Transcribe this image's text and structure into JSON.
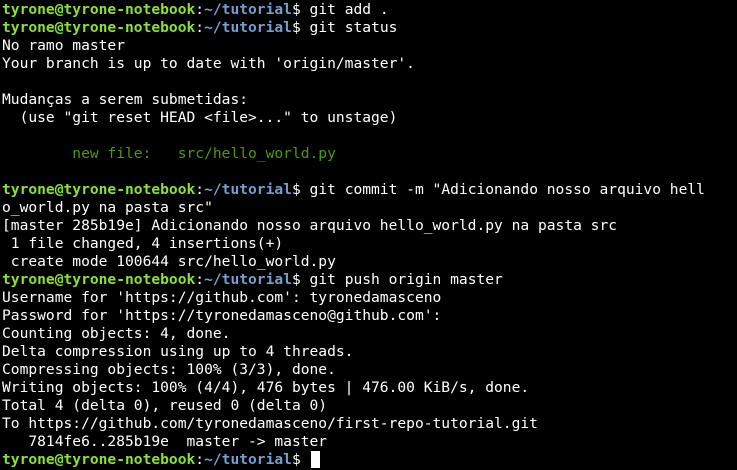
{
  "prompt": {
    "user": "tyrone@tyrone-notebook",
    "colon": ":",
    "path": "~/tutorial",
    "dollar": "$ "
  },
  "lines": [
    {
      "type": "prompt",
      "cmd": "git add ."
    },
    {
      "type": "prompt",
      "cmd": "git status"
    },
    {
      "type": "text",
      "text": "No ramo master"
    },
    {
      "type": "text",
      "text": "Your branch is up to date with 'origin/master'."
    },
    {
      "type": "text",
      "text": ""
    },
    {
      "type": "text",
      "text": "Mudanças a serem submetidas:"
    },
    {
      "type": "text",
      "text": "  (use \"git reset HEAD <file>...\" to unstage)"
    },
    {
      "type": "text",
      "text": ""
    },
    {
      "type": "green",
      "text": "\tnew file:   src/hello_world.py"
    },
    {
      "type": "text",
      "text": ""
    },
    {
      "type": "prompt",
      "cmd": "git commit -m \"Adicionando nosso arquivo hell"
    },
    {
      "type": "text",
      "text": "o_world.py na pasta src\""
    },
    {
      "type": "text",
      "text": "[master 285b19e] Adicionando nosso arquivo hello_world.py na pasta src"
    },
    {
      "type": "text",
      "text": " 1 file changed, 4 insertions(+)"
    },
    {
      "type": "text",
      "text": " create mode 100644 src/hello_world.py"
    },
    {
      "type": "prompt",
      "cmd": "git push origin master"
    },
    {
      "type": "text",
      "text": "Username for 'https://github.com': tyronedamasceno"
    },
    {
      "type": "text",
      "text": "Password for 'https://tyronedamasceno@github.com':"
    },
    {
      "type": "text",
      "text": "Counting objects: 4, done."
    },
    {
      "type": "text",
      "text": "Delta compression using up to 4 threads."
    },
    {
      "type": "text",
      "text": "Compressing objects: 100% (3/3), done."
    },
    {
      "type": "text",
      "text": "Writing objects: 100% (4/4), 476 bytes | 476.00 KiB/s, done."
    },
    {
      "type": "text",
      "text": "Total 4 (delta 0), reused 0 (delta 0)"
    },
    {
      "type": "text",
      "text": "To https://github.com/tyronedamasceno/first-repo-tutorial.git"
    },
    {
      "type": "text",
      "text": "   7814fe6..285b19e  master -> master"
    },
    {
      "type": "prompt",
      "cmd": "",
      "cursor": true
    }
  ],
  "colors": {
    "background": "#000000",
    "foreground": "#ffffff",
    "user": "#8ae234",
    "path": "#729fcf",
    "staged": "#4e9a06"
  }
}
